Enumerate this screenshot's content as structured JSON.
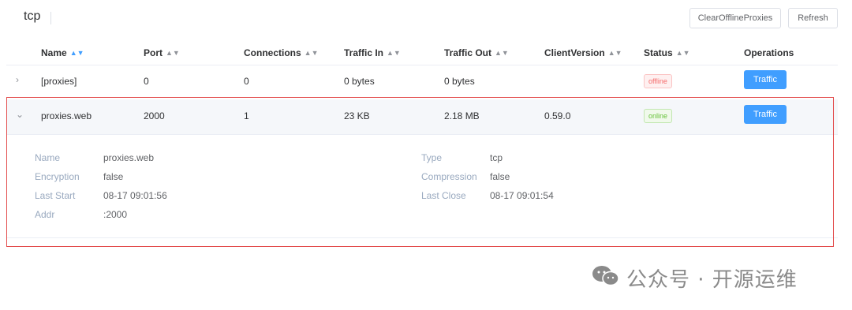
{
  "header": {
    "title": "tcp",
    "clear_offline_label": "ClearOfflineProxies",
    "refresh_label": "Refresh"
  },
  "table": {
    "columns": [
      "Name",
      "Port",
      "Connections",
      "Traffic In",
      "Traffic Out",
      "ClientVersion",
      "Status",
      "Operations"
    ],
    "rows": [
      {
        "expand_icon": "chevron-right-icon",
        "name": "[proxies]",
        "port": "0",
        "connections": "0",
        "traffic_in": "0 bytes",
        "traffic_out": "0 bytes",
        "client_version": "",
        "status": "offline",
        "operation": "Traffic"
      },
      {
        "expand_icon": "chevron-down-icon",
        "name": "proxies.web",
        "port": "2000",
        "connections": "1",
        "traffic_in": "23 KB",
        "traffic_out": "2.18 MB",
        "client_version": "0.59.0",
        "status": "online",
        "operation": "Traffic"
      }
    ]
  },
  "detail": {
    "name_label": "Name",
    "name_value": "proxies.web",
    "type_label": "Type",
    "type_value": "tcp",
    "encryption_label": "Encryption",
    "encryption_value": "false",
    "compression_label": "Compression",
    "compression_value": "false",
    "last_start_label": "Last Start",
    "last_start_value": "08-17 09:01:56",
    "last_close_label": "Last Close",
    "last_close_value": "08-17 09:01:54",
    "addr_label": "Addr",
    "addr_value": ":2000"
  },
  "watermark": {
    "icon": "wechat-icon",
    "text": "公众号 · 开源运维"
  },
  "colors": {
    "primary": "#409eff",
    "offline": "#f56c6c",
    "online": "#67c23a",
    "highlight_border": "#e34d4d"
  }
}
